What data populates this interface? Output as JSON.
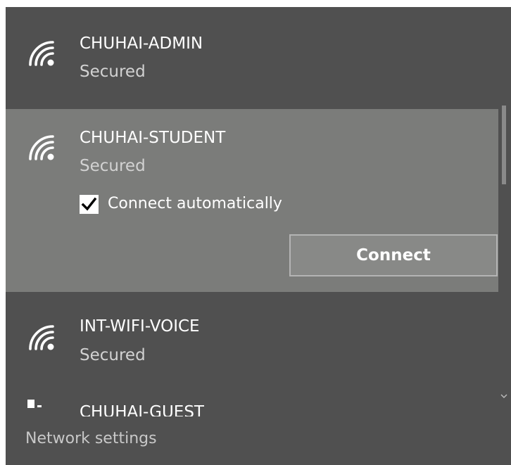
{
  "networks": [
    {
      "name": "CHUHAI-ADMIN",
      "status": "Secured"
    },
    {
      "name": "CHUHAI-STUDENT",
      "status": "Secured",
      "auto_connect_label": "Connect automatically",
      "auto_connect_checked": true,
      "connect_label": "Connect"
    },
    {
      "name": "INT-WIFI-VOICE",
      "status": "Secured"
    },
    {
      "name": "CHUHAI-GUEST"
    }
  ],
  "footer": {
    "settings_label": "Network settings"
  },
  "icons": {
    "wifi": "wifi-signal-icon",
    "checkbox": "checkmark-icon",
    "scroll_down": "chevron-down-icon",
    "partial": "shield-wifi-icon"
  },
  "colors": {
    "flyout_bg": "#505050",
    "selected_bg": "#7b7c7a",
    "button_bg": "#888987",
    "button_border": "#b4b4b4",
    "text": "#ffffff",
    "secondary_text": "#d2d2d2"
  }
}
